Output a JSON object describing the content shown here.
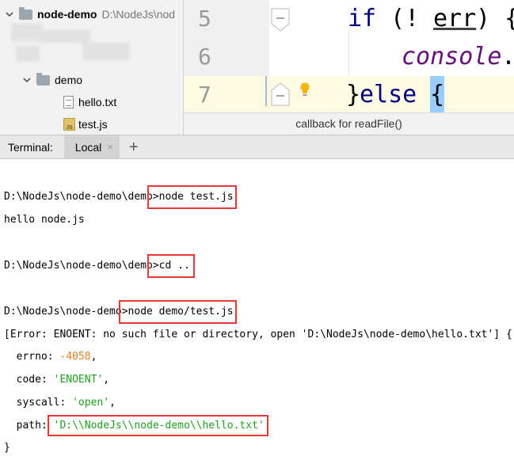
{
  "project_tree": {
    "root": {
      "name": "node-demo",
      "path": "D:\\NodeJs\\nod"
    },
    "folder": "demo",
    "files": [
      "hello.txt",
      "test.js"
    ]
  },
  "editor": {
    "lines": [
      {
        "number": "5",
        "tokens": [
          "if",
          " (!",
          "err",
          ") {"
        ]
      },
      {
        "number": "6",
        "tokens": [
          "console",
          "."
        ]
      },
      {
        "number": "7",
        "tokens": [
          "}",
          "else",
          " ",
          "{"
        ]
      }
    ],
    "breadcrumb": "callback for readFile()"
  },
  "terminal": {
    "tab_label": "Terminal:",
    "tab_name": "Local",
    "close_glyph": "×",
    "add_glyph": "+",
    "lines": [
      {
        "prompt": "D:\\NodeJs\\node-demo\\demo>",
        "cmd": "node test.js"
      },
      {
        "out": "hello node.js"
      },
      {
        "prompt": "D:\\NodeJs\\node-demo\\demo>",
        "cmd": "cd .."
      },
      {
        "prompt": "D:\\NodeJs\\node-demo>",
        "cmd": "node demo/test.js"
      },
      {
        "out": "[Error: ENOENT: no such file or directory, open 'D:\\NodeJs\\node-demo\\hello.txt'] {"
      },
      {
        "key": "  errno: ",
        "value": "-4058",
        "trail": ","
      },
      {
        "key": "  code: ",
        "value": "'ENOENT'",
        "trail": ","
      },
      {
        "key": "  syscall: ",
        "value": "'open'",
        "trail": ","
      },
      {
        "key": "  path: ",
        "value": "'D:\\\\NodeJs\\\\node-demo\\\\hello.txt'",
        "trail": ""
      },
      {
        "out": "}"
      }
    ]
  },
  "colors": {
    "keyword": "#000080",
    "function": "#660e7a",
    "number": "#e5801f",
    "string": "#1ea11e",
    "highlight_box": "#e53935"
  }
}
